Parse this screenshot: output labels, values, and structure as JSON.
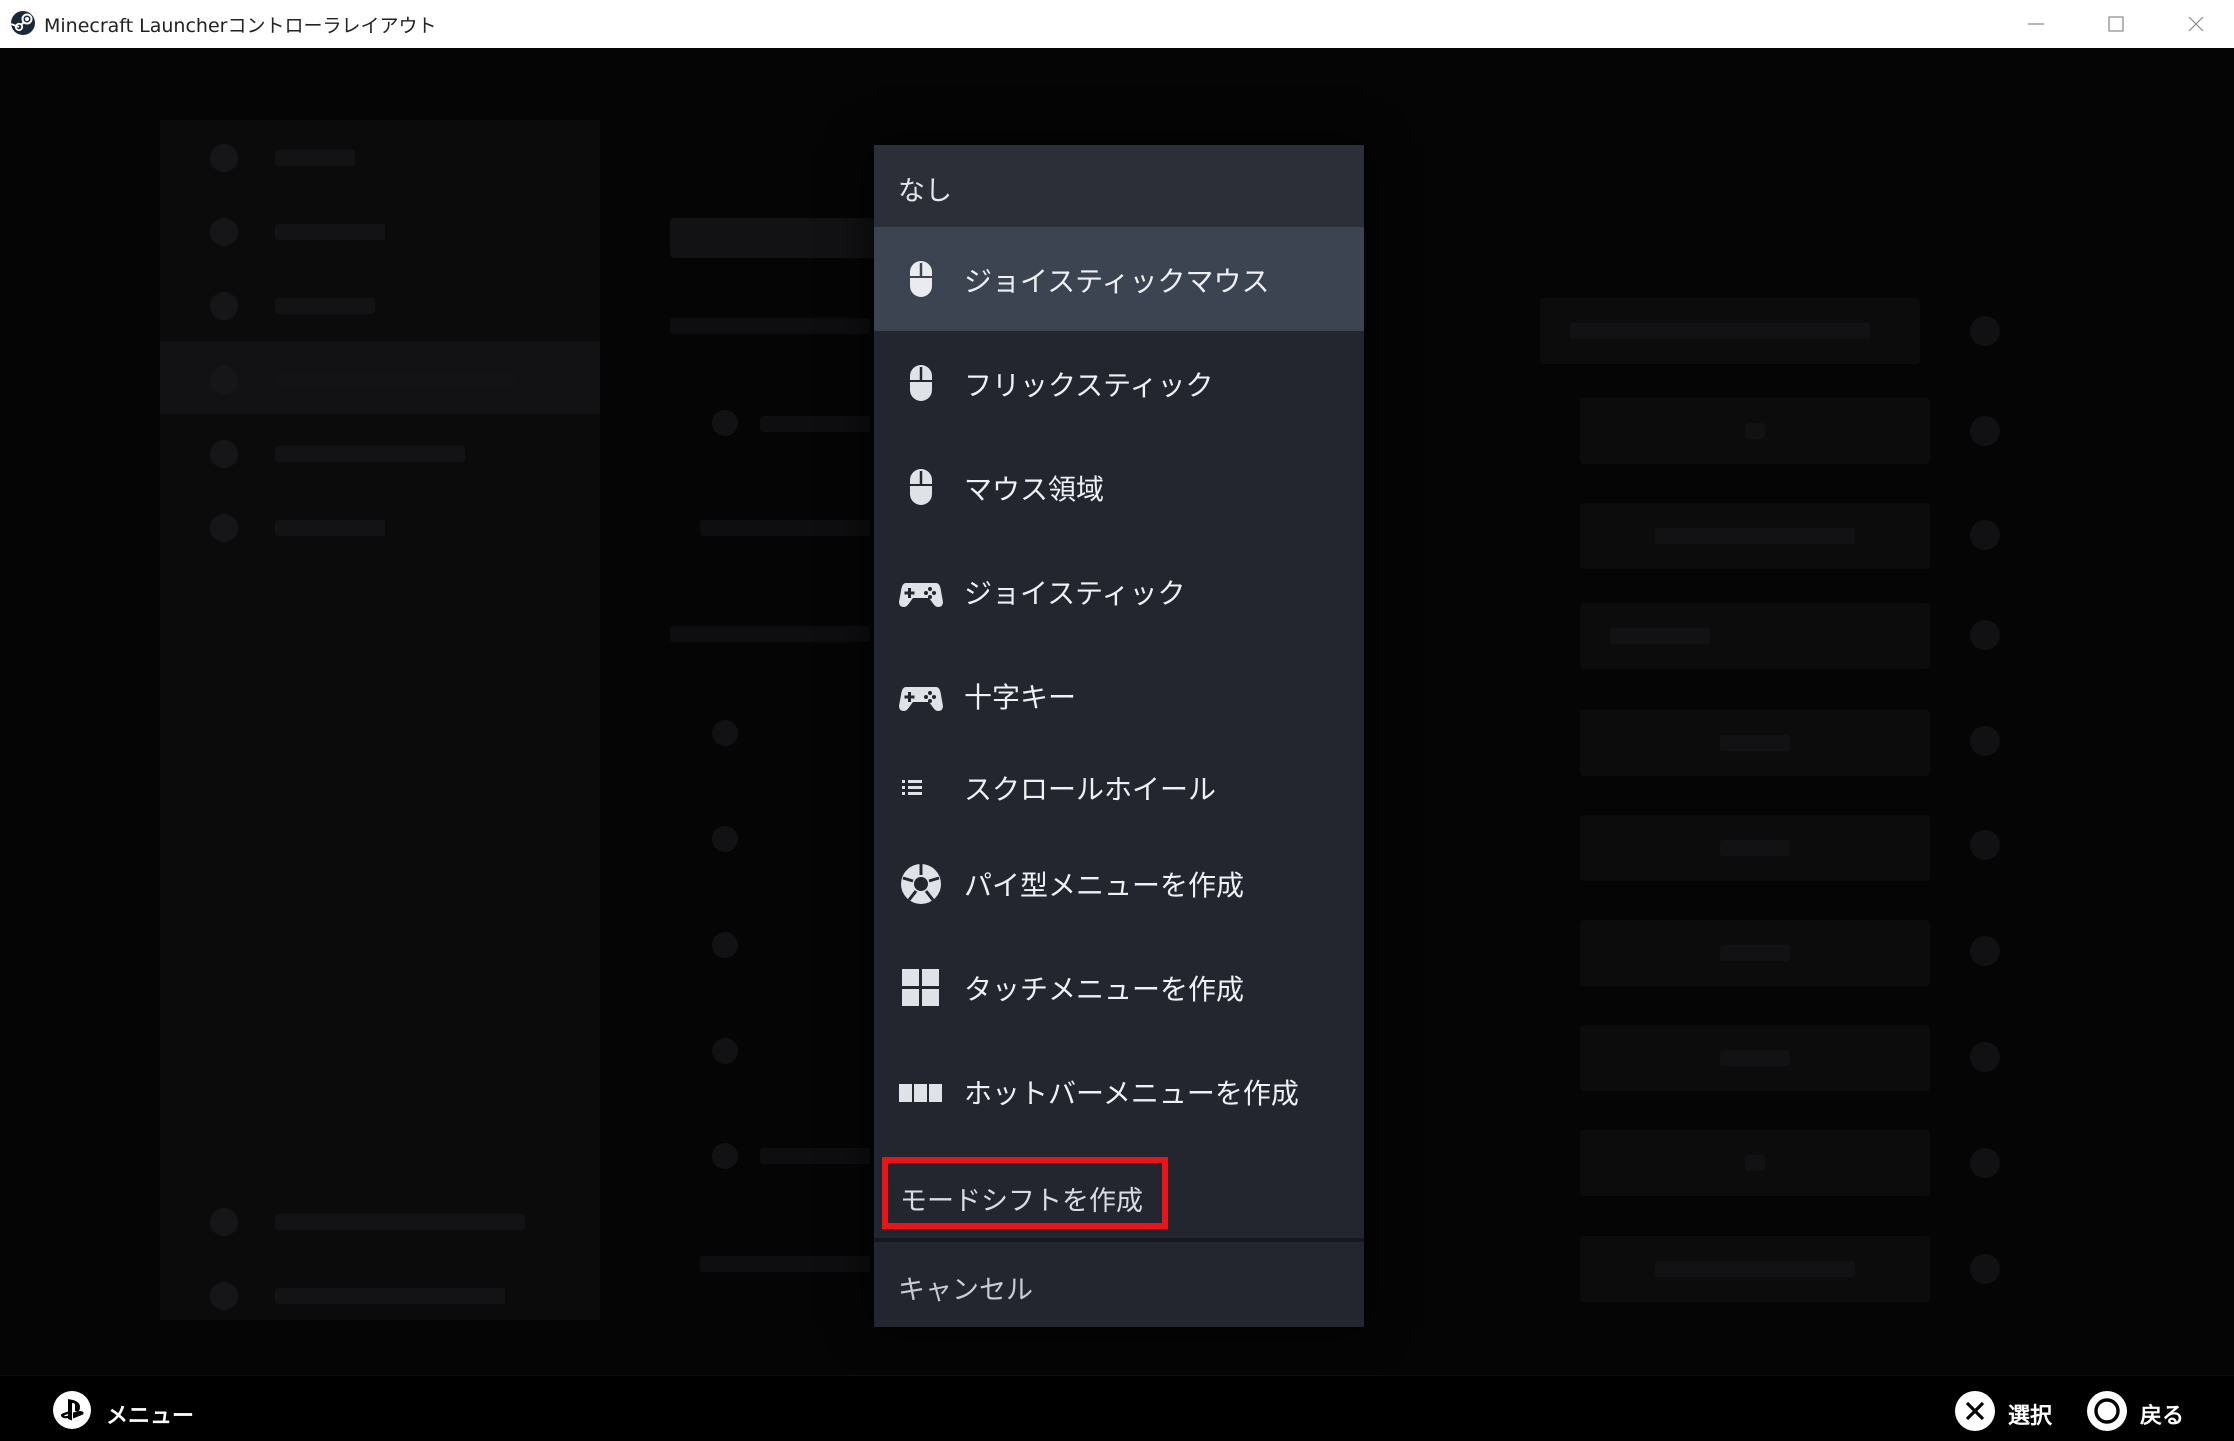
{
  "window": {
    "title": "Minecraft Launcherコントローラレイアウト"
  },
  "menu": {
    "none_label": "なし",
    "items": [
      {
        "label": "ジョイスティックマウス",
        "icon": "mouse-icon",
        "selected": true
      },
      {
        "label": "フリックスティック",
        "icon": "mouse-icon",
        "selected": false
      },
      {
        "label": "マウス領域",
        "icon": "mouse-icon",
        "selected": false
      },
      {
        "label": "ジョイスティック",
        "icon": "gamepad-icon",
        "selected": false
      },
      {
        "label": "十字キー",
        "icon": "gamepad-icon",
        "selected": false
      },
      {
        "label": "スクロールホイール",
        "icon": "list-icon",
        "selected": false
      },
      {
        "label": "パイ型メニューを作成",
        "icon": "pie-menu-icon",
        "selected": false
      },
      {
        "label": "タッチメニューを作成",
        "icon": "grid-icon",
        "selected": false
      },
      {
        "label": "ホットバーメニューを作成",
        "icon": "hotbar-icon",
        "selected": false
      }
    ],
    "mode_shift_label": "モードシフトを作成",
    "cancel_label": "キャンセル",
    "highlight_color": "#e8141a"
  },
  "footer": {
    "menu_label": "メニュー",
    "select_label": "選択",
    "back_label": "戻る"
  }
}
